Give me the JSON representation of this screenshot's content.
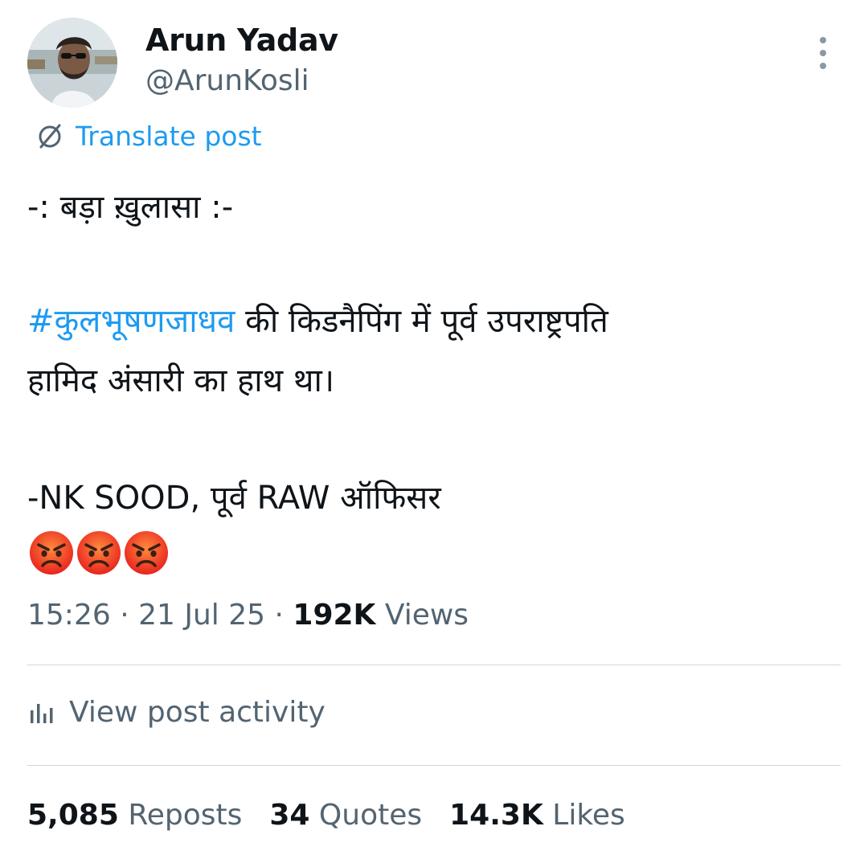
{
  "author": {
    "display_name": "Arun Yadav",
    "handle": "@ArunKosli",
    "avatar_icon": "profile-photo"
  },
  "actions": {
    "more_icon": "vertical-ellipsis-icon",
    "translate_label": "Translate post",
    "translate_icon": "globe-icon"
  },
  "post": {
    "line1": "-: बड़ा ख़ुलासा :-",
    "hashtag": "#कुलभूषणजाधव",
    "line2_rest": " की किडनैपिंग में पूर्व उपराष्ट्रपति",
    "line3": "हामिद अंसारी का हाथ था।",
    "line4": "-NK SOOD, पूर्व RAW ऑफिसर",
    "emojis": [
      "angry-face",
      "angry-face",
      "angry-face"
    ]
  },
  "meta": {
    "time": "15:26",
    "sep1": " · ",
    "date": "21 Jul 25",
    "sep2": " · ",
    "views_count": "192K",
    "views_label": " Views"
  },
  "activity": {
    "label": "View post activity",
    "icon": "analytics-bars-icon"
  },
  "stats": {
    "reposts_count": "5,085",
    "reposts_label": " Reposts",
    "quotes_count": "34",
    "quotes_label": " Quotes",
    "likes_count": "14.3K",
    "likes_label": " Likes"
  },
  "colors": {
    "link": "#1d9bf0",
    "secondary_text": "#536471",
    "primary_text": "#0f1419",
    "divider": "#cfd9de"
  }
}
